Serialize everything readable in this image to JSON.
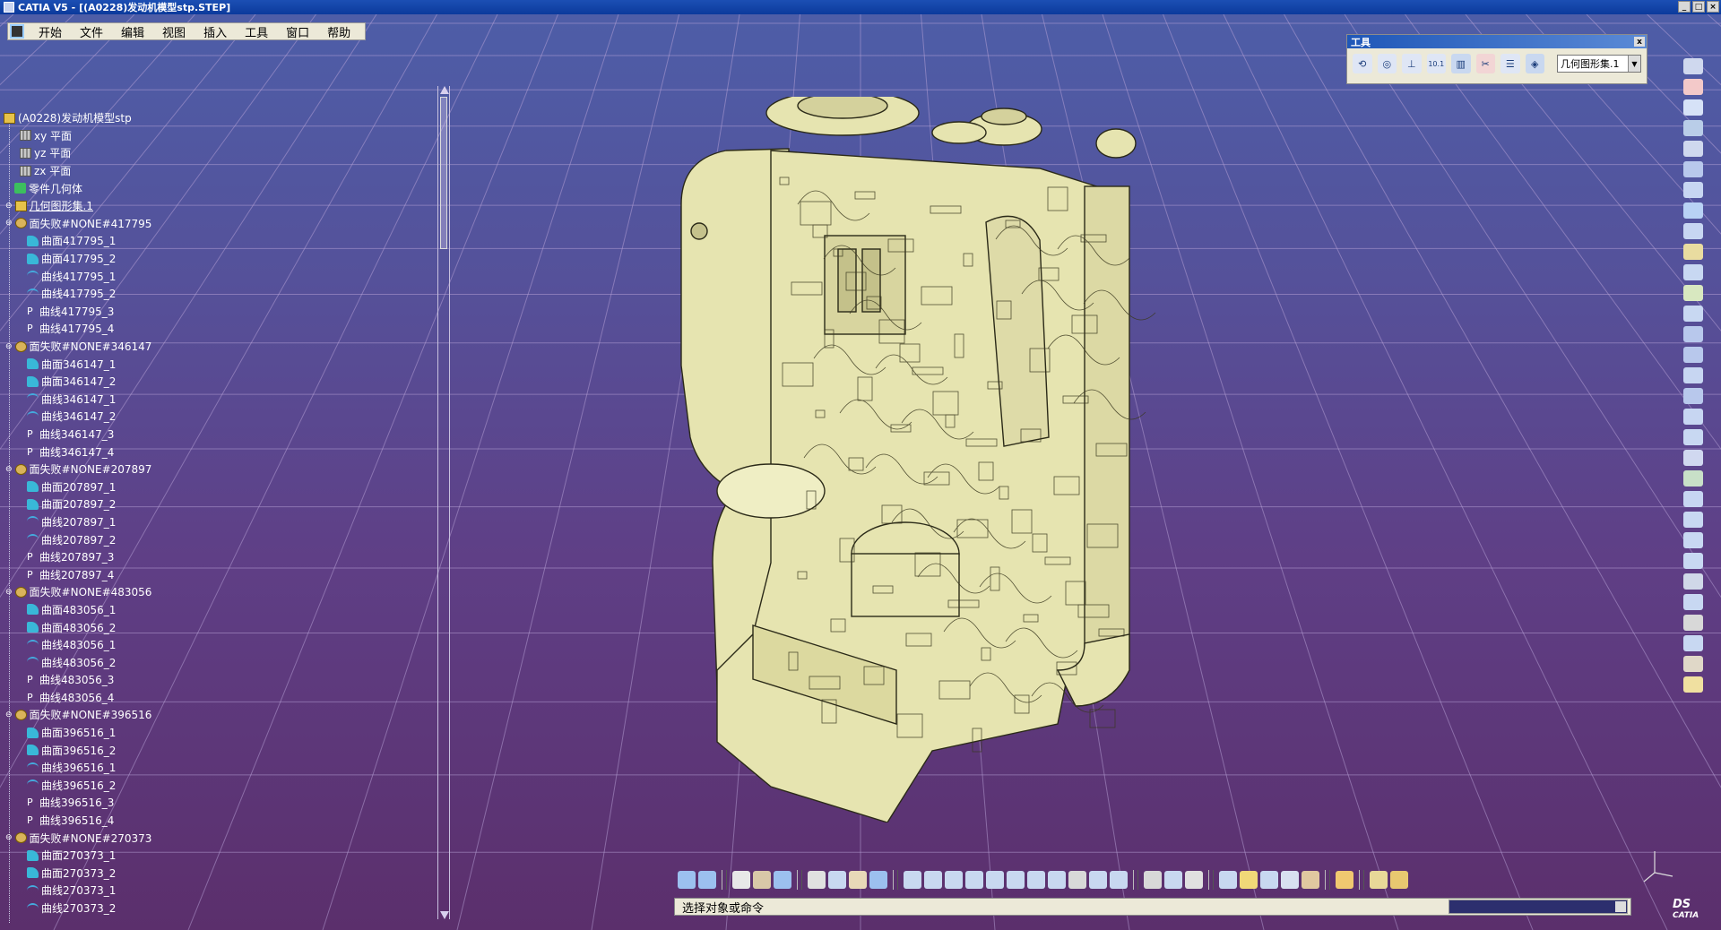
{
  "window": {
    "title": "CATIA V5 - [(A0228)发动机模型stp.STEP]"
  },
  "menu": {
    "items": [
      "开始",
      "文件",
      "编辑",
      "视图",
      "插入",
      "工具",
      "窗口",
      "帮助"
    ]
  },
  "tree": {
    "root": "(A0228)发动机模型stp",
    "planes": [
      "xy 平面",
      "yz 平面",
      "zx 平面"
    ],
    "body": "零件几何体",
    "geoset": "几何图形集.1",
    "groups": [
      {
        "label": "面失败#NONE#417795",
        "items": [
          "曲面417795_1",
          "曲面417795_2",
          "曲线417795_1",
          "曲线417795_2",
          "曲线417795_3",
          "曲线417795_4"
        ]
      },
      {
        "label": "面失败#NONE#346147",
        "items": [
          "曲面346147_1",
          "曲面346147_2",
          "曲线346147_1",
          "曲线346147_2",
          "曲线346147_3",
          "曲线346147_4"
        ]
      },
      {
        "label": "面失败#NONE#207897",
        "items": [
          "曲面207897_1",
          "曲面207897_2",
          "曲线207897_1",
          "曲线207897_2",
          "曲线207897_3",
          "曲线207897_4"
        ]
      },
      {
        "label": "面失败#NONE#483056",
        "items": [
          "曲面483056_1",
          "曲面483056_2",
          "曲线483056_1",
          "曲线483056_2",
          "曲线483056_3",
          "曲线483056_4"
        ]
      },
      {
        "label": "面失败#NONE#396516",
        "items": [
          "曲面396516_1",
          "曲面396516_2",
          "曲线396516_1",
          "曲线396516_2",
          "曲线396516_3",
          "曲线396516_4"
        ]
      },
      {
        "label": "面失败#NONE#270373",
        "items": [
          "曲面270373_1",
          "曲面270373_2",
          "曲线270373_1",
          "曲线270373_2"
        ]
      }
    ],
    "p_prefix": "P"
  },
  "tools_panel": {
    "title": "工具",
    "close": "x",
    "geo_select": "几何图形集.1",
    "num_icon": "10.1"
  },
  "status": {
    "prompt": "选择对象或命令"
  },
  "logo": {
    "line1": "DS",
    "line2": "CATIA"
  },
  "colors": {
    "engine": "#e6e4b0",
    "engine_line": "#2b2a18",
    "background_top": "#4d5ea8",
    "background_bottom": "#5b2f6c"
  }
}
